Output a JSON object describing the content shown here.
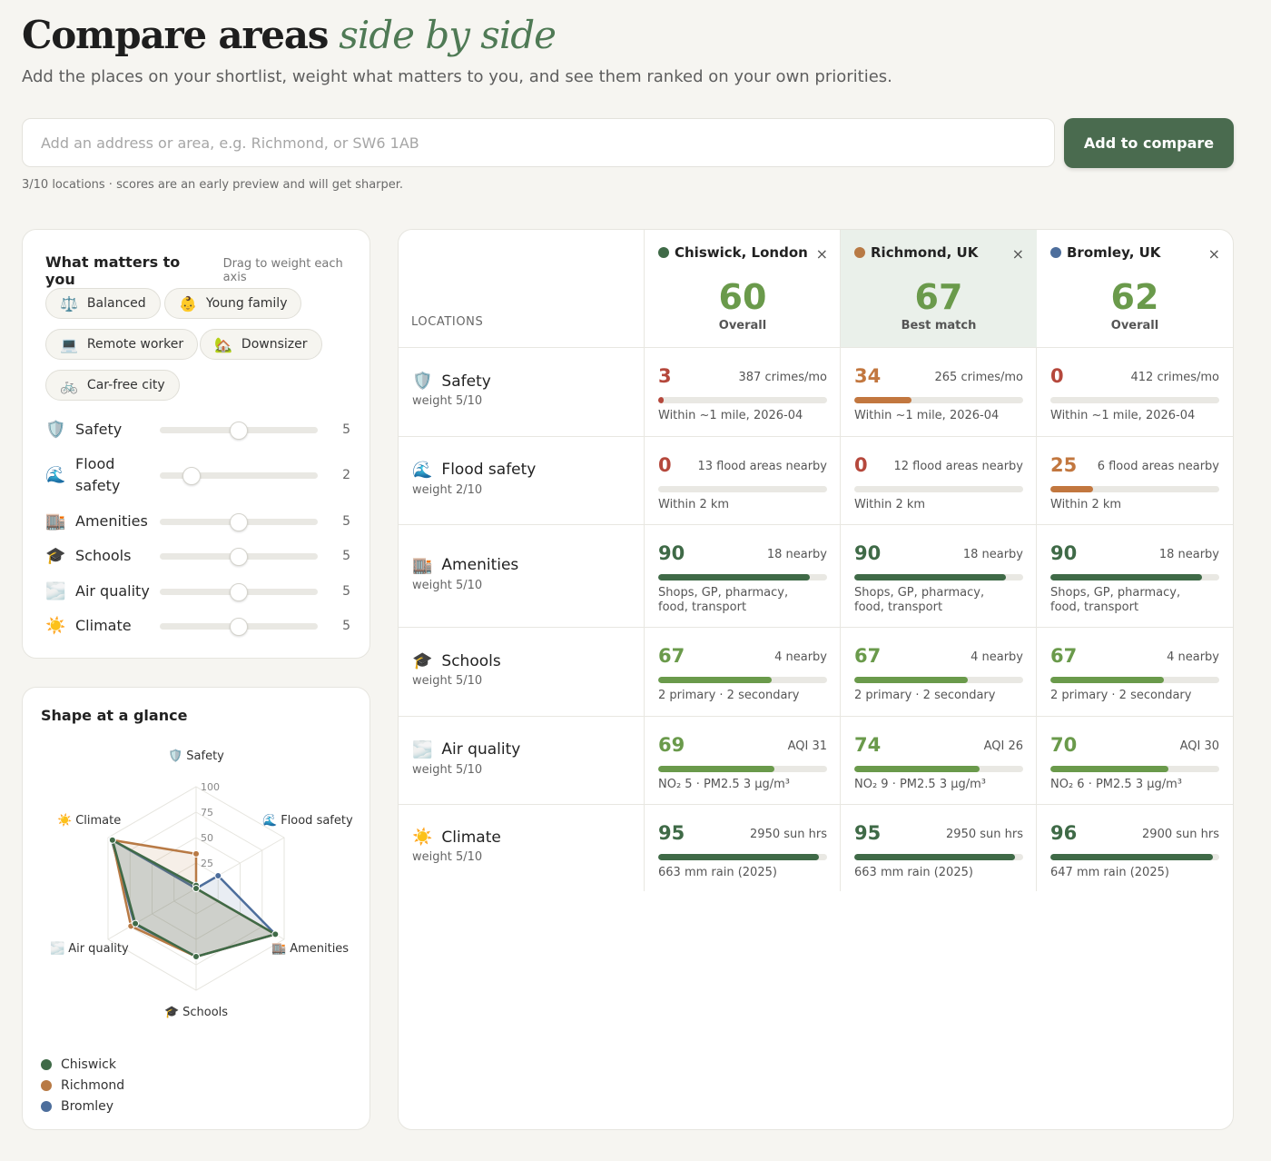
{
  "header": {
    "title_main": "Compare areas",
    "title_accent": "side by side",
    "subtitle": "Add the places on your shortlist, weight what matters to you, and see them ranked on your own priorities."
  },
  "search": {
    "placeholder": "Add an address or area, e.g. Richmond, or SW6 1AB",
    "value": "",
    "button_label": "Add to compare",
    "note": "3/10 locations · scores are an early preview and will get sharper."
  },
  "weights": {
    "title": "What matters to you",
    "hint": "Drag to weight each axis",
    "presets": [
      {
        "icon": "⚖️",
        "label": "Balanced"
      },
      {
        "icon": "👶",
        "label": "Young family"
      },
      {
        "icon": "💻",
        "label": "Remote worker"
      },
      {
        "icon": "🏡",
        "label": "Downsizer"
      },
      {
        "icon": "🚲",
        "label": "Car-free city"
      }
    ],
    "axes": [
      {
        "icon": "🛡️",
        "label": "Safety",
        "value": 5
      },
      {
        "icon": "🌊",
        "label": "Flood safety",
        "value": 2
      },
      {
        "icon": "🏬",
        "label": "Amenities",
        "value": 5
      },
      {
        "icon": "🎓",
        "label": "Schools",
        "value": 5
      },
      {
        "icon": "🌫️",
        "label": "Air quality",
        "value": 5
      },
      {
        "icon": "☀️",
        "label": "Climate",
        "value": 5
      }
    ],
    "max": 10
  },
  "shape": {
    "title": "Shape at a glance",
    "axis_labels": [
      {
        "icon": "🛡️",
        "label": "Safety"
      },
      {
        "icon": "🌊",
        "label": "Flood safety"
      },
      {
        "icon": "🏬",
        "label": "Amenities"
      },
      {
        "icon": "🎓",
        "label": "Schools"
      },
      {
        "icon": "🌫️",
        "label": "Air quality"
      },
      {
        "icon": "☀️",
        "label": "Climate"
      }
    ],
    "ticks": [
      "25",
      "50",
      "75",
      "100"
    ],
    "legend": [
      {
        "name": "Chiswick",
        "color": "#3f6a47"
      },
      {
        "name": "Richmond",
        "color": "#b87a45"
      },
      {
        "name": "Bromley",
        "color": "#4d6e9c"
      }
    ]
  },
  "table": {
    "locations_label": "LOCATIONS",
    "columns": [
      {
        "name": "Chiswick, London",
        "dot_color": "#3f6a47",
        "score": "60",
        "sub": "Overall",
        "best": false
      },
      {
        "name": "Richmond, UK",
        "dot_color": "#b87a45",
        "score": "67",
        "sub": "Best match",
        "best": true
      },
      {
        "name": "Bromley, UK",
        "dot_color": "#4d6e9c",
        "score": "62",
        "sub": "Overall",
        "best": false
      }
    ],
    "close_symbol": "×",
    "rows": [
      {
        "icon": "🛡️",
        "label": "Safety",
        "weight": "weight 5/10",
        "cells": [
          {
            "score": "3",
            "value": 3,
            "metric": "387 crimes/mo",
            "detail": "Within ~1 mile, 2026-04",
            "color": "#b5483c"
          },
          {
            "score": "34",
            "value": 34,
            "metric": "265 crimes/mo",
            "detail": "Within ~1 mile, 2026-04",
            "color": "#c2773f"
          },
          {
            "score": "0",
            "value": 0,
            "metric": "412 crimes/mo",
            "detail": "Within ~1 mile, 2026-04",
            "color": "#b5483c"
          }
        ]
      },
      {
        "icon": "🌊",
        "label": "Flood safety",
        "weight": "weight 2/10",
        "cells": [
          {
            "score": "0",
            "value": 0,
            "metric": "13 flood areas nearby",
            "detail": "Within 2 km",
            "color": "#b5483c"
          },
          {
            "score": "0",
            "value": 0,
            "metric": "12 flood areas nearby",
            "detail": "Within 2 km",
            "color": "#b5483c"
          },
          {
            "score": "25",
            "value": 25,
            "metric": "6 flood areas nearby",
            "detail": "Within 2 km",
            "color": "#c2773f"
          }
        ]
      },
      {
        "icon": "🏬",
        "label": "Amenities",
        "weight": "weight 5/10",
        "cells": [
          {
            "score": "90",
            "value": 90,
            "metric": "18 nearby",
            "detail": "Shops, GP, pharmacy, food, transport",
            "color": "#3f6a47"
          },
          {
            "score": "90",
            "value": 90,
            "metric": "18 nearby",
            "detail": "Shops, GP, pharmacy, food, transport",
            "color": "#3f6a47"
          },
          {
            "score": "90",
            "value": 90,
            "metric": "18 nearby",
            "detail": "Shops, GP, pharmacy, food, transport",
            "color": "#3f6a47"
          }
        ]
      },
      {
        "icon": "🎓",
        "label": "Schools",
        "weight": "weight 5/10",
        "cells": [
          {
            "score": "67",
            "value": 67,
            "metric": "4 nearby",
            "detail": "2 primary · 2 secondary",
            "color": "#6a9a4b"
          },
          {
            "score": "67",
            "value": 67,
            "metric": "4 nearby",
            "detail": "2 primary · 2 secondary",
            "color": "#6a9a4b"
          },
          {
            "score": "67",
            "value": 67,
            "metric": "4 nearby",
            "detail": "2 primary · 2 secondary",
            "color": "#6a9a4b"
          }
        ]
      },
      {
        "icon": "🌫️",
        "label": "Air quality",
        "weight": "weight 5/10",
        "cells": [
          {
            "score": "69",
            "value": 69,
            "metric": "AQI 31",
            "detail": "NO₂ 5 · PM2.5 3 µg/m³",
            "color": "#6a9a4b"
          },
          {
            "score": "74",
            "value": 74,
            "metric": "AQI 26",
            "detail": "NO₂ 9 · PM2.5 3 µg/m³",
            "color": "#6a9a4b"
          },
          {
            "score": "70",
            "value": 70,
            "metric": "AQI 30",
            "detail": "NO₂ 6 · PM2.5 3 µg/m³",
            "color": "#6a9a4b"
          }
        ]
      },
      {
        "icon": "☀️",
        "label": "Climate",
        "weight": "weight 5/10",
        "cells": [
          {
            "score": "95",
            "value": 95,
            "metric": "2950 sun hrs",
            "detail": "663 mm rain (2025)",
            "color": "#3f6a47"
          },
          {
            "score": "95",
            "value": 95,
            "metric": "2950 sun hrs",
            "detail": "663 mm rain (2025)",
            "color": "#3f6a47"
          },
          {
            "score": "96",
            "value": 96,
            "metric": "2900 sun hrs",
            "detail": "647 mm rain (2025)",
            "color": "#3f6a47"
          }
        ]
      }
    ]
  }
}
